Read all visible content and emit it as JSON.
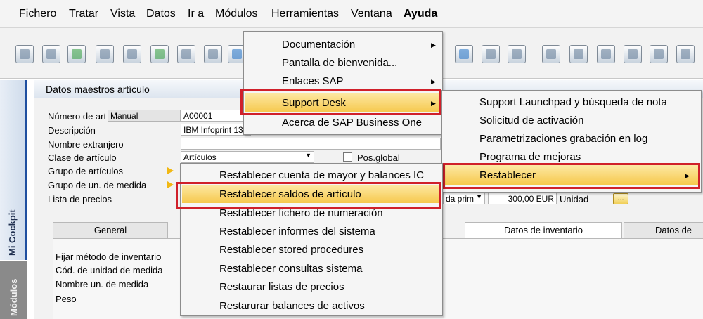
{
  "menubar": {
    "items": [
      "Fichero",
      "Tratar",
      "Vista",
      "Datos",
      "Ir a",
      "Módulos",
      "Herramientas",
      "Ventana",
      "Ayuda"
    ]
  },
  "sidebar": {
    "cockpit_tab": "Mi Cockpit",
    "second_tab": "Módulos"
  },
  "window": {
    "title": "Datos maestros artículo",
    "labels": {
      "item_number": "Número de artículo",
      "description": "Descripción",
      "foreign_name": "Nombre extranjero",
      "item_class": "Clase de artículo",
      "item_group": "Grupo de artículos",
      "uom_group": "Grupo de un. de medida",
      "price_list": "Lista de precios"
    },
    "fields": {
      "number_series": "Manual",
      "item_number": "A00001",
      "description": "IBM Infoprint 1312",
      "item_class": "Artículos",
      "price_list": "da prim",
      "price": "300,00 EUR",
      "unit_label": "Unidad",
      "dots": "..."
    },
    "checkbox_label": "Pos.global",
    "tabs": [
      "General",
      "Datos de inventario",
      "Datos de"
    ],
    "inventory_labels": [
      "Fijar método de inventario",
      "Cód. de unidad de medida",
      "Nombre un. de medida",
      "Peso"
    ]
  },
  "help_menu": {
    "items": [
      "Documentación",
      "Pantalla de bienvenida...",
      "Enlaces SAP",
      "Support Desk",
      "Acerca de SAP Business One"
    ],
    "arrow": "▶"
  },
  "support_menu": {
    "items": [
      "Support Launchpad y búsqueda de nota",
      "Solicitud de activación",
      "Parametrizaciones grabación en log",
      "Programa de mejoras",
      "Restablecer"
    ],
    "arrow": "▶"
  },
  "reset_menu": {
    "items": [
      "Restablecer cuenta de mayor y balances IC",
      "Restablecer saldos de artículo",
      "Restablecer fichero de numeración",
      "Restablecer informes del sistema",
      "Restablecer stored procedures",
      "Restablecer consultas sistema",
      "Restaurar listas de precios",
      "Restarurar balances de activos"
    ]
  },
  "colors": {
    "highlight": "#f6c84c",
    "callout": "#d0202a"
  }
}
